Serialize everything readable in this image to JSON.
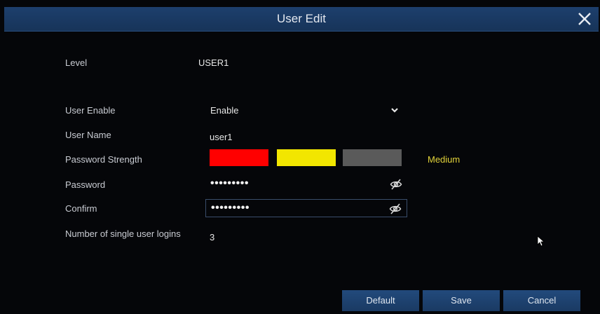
{
  "dialog": {
    "title": "User Edit",
    "close_icon": "close-icon"
  },
  "fields": {
    "level": {
      "label": "Level",
      "value": "USER1"
    },
    "user_enable": {
      "label": "User Enable",
      "value": "Enable"
    },
    "user_name": {
      "label": "User Name",
      "value": "user1"
    },
    "password_strength": {
      "label": "Password Strength",
      "value": "Medium",
      "level": 2,
      "max": 3,
      "colors": [
        "#ff0000",
        "#f2e600",
        "#5a5a5a"
      ]
    },
    "password": {
      "label": "Password",
      "value": "•••••••••"
    },
    "confirm": {
      "label": "Confirm",
      "value": "•••••••••"
    },
    "logins": {
      "label": "Number of single user logins",
      "value": "3"
    }
  },
  "buttons": {
    "default_label": "Default",
    "save_label": "Save",
    "cancel_label": "Cancel"
  }
}
